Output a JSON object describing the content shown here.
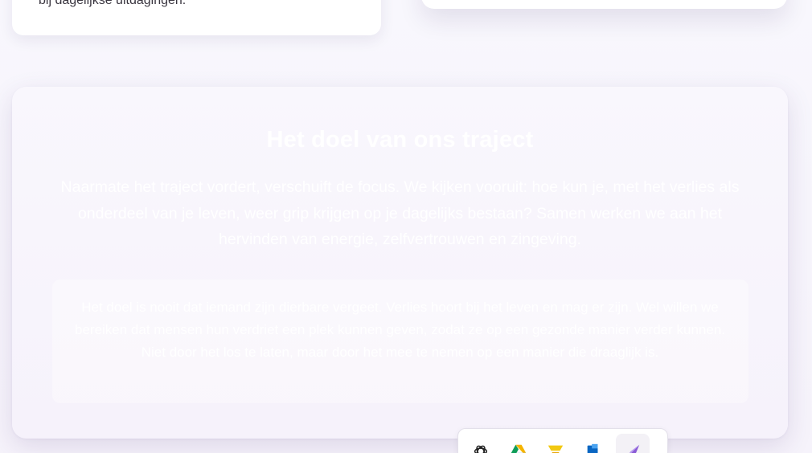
{
  "cards": {
    "left_text": "bij dagelijkse uitdagingen."
  },
  "doel": {
    "title": "Het doel van ons traject",
    "intro": "Naarmate het traject vordert, verschuift de focus. We kijken vooruit: hoe kun je, met het verlies als onderdeel van je leven, weer grip krijgen op je dagelijks bestaan? Samen werken we aan het hervinden van energie, zelfvertrouwen en zingeving.",
    "quote": "Het doel is nooit dat iemand zijn dierbare vergeet. Verlies hoort bij het leven en mag er zijn. Wel willen we bereiken dat mensen hun verdriet een plek kunnen geven, zodat ze op een gezonde manier verder kunnen. Niet door het los te laten, maar door het mee te nemen op een manier die draaglijk is."
  },
  "dock": {
    "icons": [
      "openai-icon",
      "google-drive-icon",
      "power-bi-icon",
      "azure-icon",
      "pen-tool-icon"
    ]
  },
  "colors": {
    "page_bg": "#f7f5fc",
    "card_bg": "#ffffff",
    "dock_active_bg": "#f3f1f6"
  }
}
